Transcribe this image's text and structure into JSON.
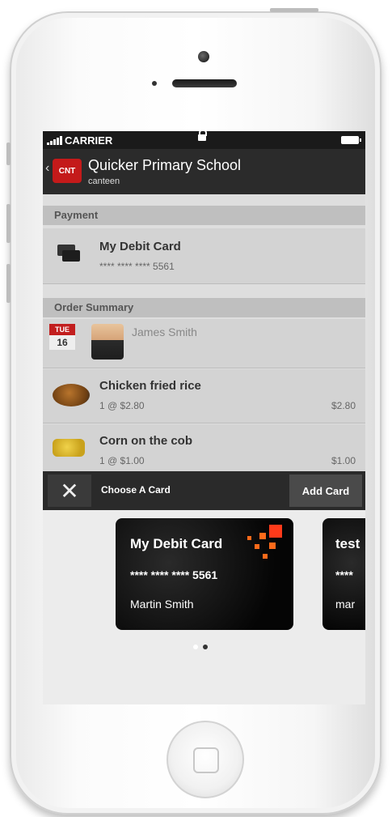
{
  "status_bar": {
    "carrier": "CARRIER"
  },
  "app_header": {
    "logo_text": "CNT",
    "title": "Quicker Primary School",
    "subtitle": "canteen"
  },
  "payment": {
    "section_label": "Payment",
    "card_name": "My Debit Card",
    "card_number": "**** **** **** 5561"
  },
  "order_summary": {
    "section_label": "Order Summary",
    "student": {
      "day": "TUE",
      "date": "16",
      "name": "James Smith"
    },
    "items": [
      {
        "name": "Chicken fried rice",
        "qty_price": "1 @ $2.80",
        "total": "$2.80"
      },
      {
        "name": "Corn on the cob",
        "qty_price": "1 @ $1.00",
        "total": "$1.00"
      }
    ]
  },
  "choose_card_bar": {
    "label": "Choose A Card",
    "add_button": "Add Card"
  },
  "cards": [
    {
      "name": "My Debit Card",
      "number": "**** **** **** 5561",
      "holder": "Martin Smith"
    },
    {
      "name": "test",
      "number": "****",
      "holder": "mar"
    }
  ],
  "pager": {
    "count": 2,
    "active": 2
  },
  "colors": {
    "accent_red": "#c21e1e",
    "card_logo_orange": "#ff6a1a",
    "dark_bar": "#2a2a2a"
  },
  "icons": [
    "signal-icon",
    "lock-icon",
    "battery-icon",
    "back-chevron-icon",
    "card-icon",
    "close-icon",
    "food-icon",
    "avatar"
  ]
}
